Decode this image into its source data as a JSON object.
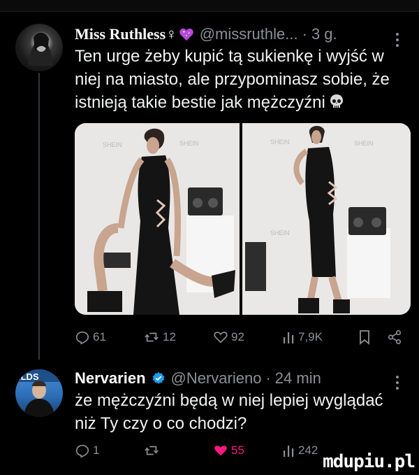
{
  "tweet1": {
    "name": "Miss Ruthless♀",
    "handle": "@missruthle...",
    "separator": "·",
    "time": "3 g.",
    "text": "Ten urge żeby kupić tą sukienkę i wyjść w niej na miasto, ale przypominasz sobie, że istnieją takie bestie jak mężczyźni",
    "actions": {
      "replies": "61",
      "retweets": "12",
      "likes": "92",
      "views": "7,9K"
    },
    "brand_text": [
      "SHEIN",
      "SHEIN",
      "SHEIN",
      "SHEIN",
      "SHEIN",
      "SHEIN",
      "SHEIN"
    ]
  },
  "tweet2": {
    "name": "Nervarien",
    "handle": "@Nervarieno",
    "separator": "·",
    "time": "24 min",
    "text": "że mężczyźni będą w niej lepiej wyglądać niż Ty czy o co chodzi?",
    "actions": {
      "replies": "1",
      "retweets": "",
      "likes": "55",
      "views": "242"
    }
  },
  "watermark": "mdupiu.pl",
  "colors": {
    "background": "#000000",
    "text": "#e7e9ea",
    "muted": "#8b9096",
    "like_active": "#f91880",
    "verified": "#1d9bf0"
  },
  "icons": [
    "reply-icon",
    "retweet-icon",
    "like-icon",
    "views-icon",
    "bookmark-icon",
    "share-icon",
    "more-icon",
    "verified-icon",
    "skull-icon",
    "purple-heart-icon"
  ]
}
